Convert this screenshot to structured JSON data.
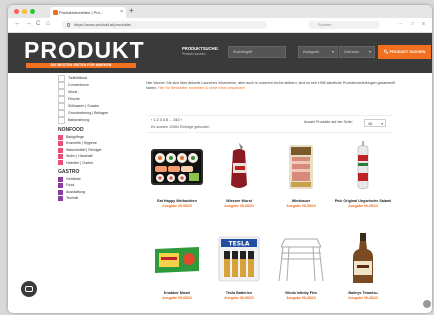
{
  "browser": {
    "tab_title": "Produktneuheiten | Pro...",
    "tab_close": "×",
    "new_tab": "+",
    "url": "https://www.produkt.at/produkte/",
    "search_placeholder": "Suchen",
    "nav_back": "←",
    "nav_forward": "→",
    "nav_reload": "C",
    "nav_home": "⌂"
  },
  "header": {
    "logo": "PRODUKT",
    "tagline": "DIE BESTEN SEITEN FÜR MARKEN",
    "search_label": "PRODUKTSUCHE:",
    "search_sub": "Produkt suchen",
    "field1": "Suchbegriff",
    "field2": "Kategorie",
    "field3": "Zeitraum",
    "search_button": "PRODUKT SUCHEN",
    "accent": "#f37021"
  },
  "sidebar": {
    "top_items": [
      {
        "label": "Tiefkühlkost",
        "color": "#ffffff"
      },
      {
        "label": "Convenience",
        "color": "#ffffff"
      },
      {
        "label": "Wurst",
        "color": "#ffffff"
      },
      {
        "label": "Frische",
        "color": "#ffffff"
      },
      {
        "label": "Süßwaren | Snacks",
        "color": "#ffffff"
      },
      {
        "label": "Grundnahrung | Beilagen",
        "color": "#ffffff"
      },
      {
        "label": "Babynahrung",
        "color": "#ffffff"
      }
    ],
    "nonfood_title": "NONFOOD",
    "nonfood_items": [
      {
        "label": "Babypflege",
        "color": "#e8507a"
      },
      {
        "label": "Kosmetik | Hygiene",
        "color": "#e8507a"
      },
      {
        "label": "Waschmittel | Reiniger",
        "color": "#e8507a"
      },
      {
        "label": "Wohn | Haushalt",
        "color": "#e8507a"
      },
      {
        "label": "Heimtier | Garten",
        "color": "#e8507a"
      }
    ],
    "gastro_title": "GASTRO",
    "gastro_items": [
      {
        "label": "Getränke",
        "color": "#8a3fa0"
      },
      {
        "label": "Food",
        "color": "#8a3fa0"
      },
      {
        "label": "Ausstattung",
        "color": "#8a3fa0"
      },
      {
        "label": "Technik",
        "color": "#8a3fa0"
      }
    ]
  },
  "main": {
    "intro": "Hier können Sie sich über aktuelle Launches informieren, aber auch in unserem Archiv stöbern, sind es seit 1998 sämtliche Produktvorstellungen gesammelt haben.",
    "intro_link": "Hier für Newsletter anmelden & keine Infos verpassen!",
    "pagination": "‹ 1 2 3 4 5 ... 310 ›",
    "count_text": "Es wurden 10584 Einträge gefunden",
    "perpage_label": "Anzahl Produkte auf der Seite:",
    "perpage_value": "48"
  },
  "products": [
    {
      "name": "Eat Happy Weihachten",
      "date": "Ausgabe 06-08/23",
      "icon": "sushi-box-image"
    },
    {
      "name": "Wiesner Wurst",
      "date": "Ausgabe 06-08/23",
      "icon": "sausage-image"
    },
    {
      "name": "Wiesbauer",
      "date": "Ausgabe 06-08/23",
      "icon": "ham-pack-image"
    },
    {
      "name": "Pick Original Ungarische Salami",
      "date": "Ausgabe 06-08/23",
      "icon": "salami-image"
    },
    {
      "name": "Knabber Mosel",
      "date": "Ausgabe 06-08/23",
      "icon": "snack-bag-image"
    },
    {
      "name": "Tesla Batterien",
      "date": "Ausgabe 06-08/23",
      "icon": "batteries-image"
    },
    {
      "name": "Vileda Infinity Flex",
      "date": "Ausgabe 06-08/23",
      "icon": "drying-rack-image"
    },
    {
      "name": "Baileys Tiramisu",
      "date": "Ausgabe 06-08/23",
      "icon": "liqueur-bottle-image"
    }
  ]
}
